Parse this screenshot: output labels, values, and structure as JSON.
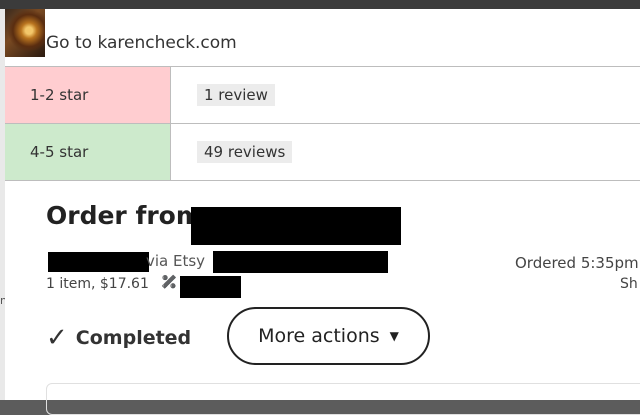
{
  "header": {
    "link_text": "Go to karencheck.com"
  },
  "ratings": [
    {
      "label": "1-2 star",
      "reviews": "1 review",
      "color": "#ffcdd0"
    },
    {
      "label": "4-5 star",
      "reviews": "49 reviews",
      "color": "#cdeacc"
    }
  ],
  "order": {
    "title": "Order from",
    "via": "via Etsy",
    "ordered": "Ordered 5:35pm",
    "items": "1 item,  $17.61",
    "ship_partial": "Sh",
    "status": "Completed",
    "more_actions_label": "More actions",
    "tag_icon": "tag-icon",
    "check_icon": "checkmark-icon",
    "caret_icon": "caret-down-icon"
  }
}
